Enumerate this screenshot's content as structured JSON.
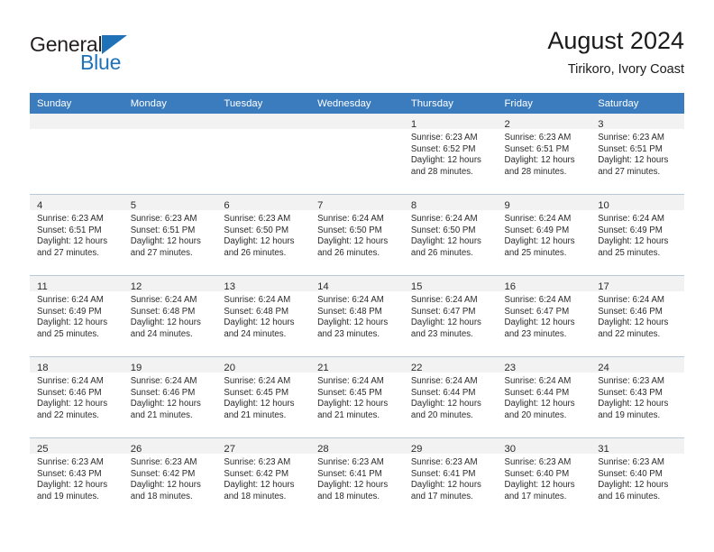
{
  "brand": {
    "name_top": "General",
    "name_bottom": "Blue",
    "accent_color": "#1f72b8",
    "text_color": "#231f20"
  },
  "header": {
    "title": "August 2024",
    "subtitle": "Tirikoro, Ivory Coast"
  },
  "theme": {
    "header_row_bg": "#3a7cbe",
    "daynum_band_bg": "#f2f2f2",
    "cell_bg": "#ffffff",
    "grid_line": "#b9c9d8",
    "text": "#2b2b2b"
  },
  "weekday_headers": [
    "Sunday",
    "Monday",
    "Tuesday",
    "Wednesday",
    "Thursday",
    "Friday",
    "Saturday"
  ],
  "weeks": [
    [
      {
        "day": "",
        "lines": []
      },
      {
        "day": "",
        "lines": []
      },
      {
        "day": "",
        "lines": []
      },
      {
        "day": "",
        "lines": []
      },
      {
        "day": "1",
        "lines": [
          "Sunrise: 6:23 AM",
          "Sunset: 6:52 PM",
          "Daylight: 12 hours",
          "and 28 minutes."
        ]
      },
      {
        "day": "2",
        "lines": [
          "Sunrise: 6:23 AM",
          "Sunset: 6:51 PM",
          "Daylight: 12 hours",
          "and 28 minutes."
        ]
      },
      {
        "day": "3",
        "lines": [
          "Sunrise: 6:23 AM",
          "Sunset: 6:51 PM",
          "Daylight: 12 hours",
          "and 27 minutes."
        ]
      }
    ],
    [
      {
        "day": "4",
        "lines": [
          "Sunrise: 6:23 AM",
          "Sunset: 6:51 PM",
          "Daylight: 12 hours",
          "and 27 minutes."
        ]
      },
      {
        "day": "5",
        "lines": [
          "Sunrise: 6:23 AM",
          "Sunset: 6:51 PM",
          "Daylight: 12 hours",
          "and 27 minutes."
        ]
      },
      {
        "day": "6",
        "lines": [
          "Sunrise: 6:23 AM",
          "Sunset: 6:50 PM",
          "Daylight: 12 hours",
          "and 26 minutes."
        ]
      },
      {
        "day": "7",
        "lines": [
          "Sunrise: 6:24 AM",
          "Sunset: 6:50 PM",
          "Daylight: 12 hours",
          "and 26 minutes."
        ]
      },
      {
        "day": "8",
        "lines": [
          "Sunrise: 6:24 AM",
          "Sunset: 6:50 PM",
          "Daylight: 12 hours",
          "and 26 minutes."
        ]
      },
      {
        "day": "9",
        "lines": [
          "Sunrise: 6:24 AM",
          "Sunset: 6:49 PM",
          "Daylight: 12 hours",
          "and 25 minutes."
        ]
      },
      {
        "day": "10",
        "lines": [
          "Sunrise: 6:24 AM",
          "Sunset: 6:49 PM",
          "Daylight: 12 hours",
          "and 25 minutes."
        ]
      }
    ],
    [
      {
        "day": "11",
        "lines": [
          "Sunrise: 6:24 AM",
          "Sunset: 6:49 PM",
          "Daylight: 12 hours",
          "and 25 minutes."
        ]
      },
      {
        "day": "12",
        "lines": [
          "Sunrise: 6:24 AM",
          "Sunset: 6:48 PM",
          "Daylight: 12 hours",
          "and 24 minutes."
        ]
      },
      {
        "day": "13",
        "lines": [
          "Sunrise: 6:24 AM",
          "Sunset: 6:48 PM",
          "Daylight: 12 hours",
          "and 24 minutes."
        ]
      },
      {
        "day": "14",
        "lines": [
          "Sunrise: 6:24 AM",
          "Sunset: 6:48 PM",
          "Daylight: 12 hours",
          "and 23 minutes."
        ]
      },
      {
        "day": "15",
        "lines": [
          "Sunrise: 6:24 AM",
          "Sunset: 6:47 PM",
          "Daylight: 12 hours",
          "and 23 minutes."
        ]
      },
      {
        "day": "16",
        "lines": [
          "Sunrise: 6:24 AM",
          "Sunset: 6:47 PM",
          "Daylight: 12 hours",
          "and 23 minutes."
        ]
      },
      {
        "day": "17",
        "lines": [
          "Sunrise: 6:24 AM",
          "Sunset: 6:46 PM",
          "Daylight: 12 hours",
          "and 22 minutes."
        ]
      }
    ],
    [
      {
        "day": "18",
        "lines": [
          "Sunrise: 6:24 AM",
          "Sunset: 6:46 PM",
          "Daylight: 12 hours",
          "and 22 minutes."
        ]
      },
      {
        "day": "19",
        "lines": [
          "Sunrise: 6:24 AM",
          "Sunset: 6:46 PM",
          "Daylight: 12 hours",
          "and 21 minutes."
        ]
      },
      {
        "day": "20",
        "lines": [
          "Sunrise: 6:24 AM",
          "Sunset: 6:45 PM",
          "Daylight: 12 hours",
          "and 21 minutes."
        ]
      },
      {
        "day": "21",
        "lines": [
          "Sunrise: 6:24 AM",
          "Sunset: 6:45 PM",
          "Daylight: 12 hours",
          "and 21 minutes."
        ]
      },
      {
        "day": "22",
        "lines": [
          "Sunrise: 6:24 AM",
          "Sunset: 6:44 PM",
          "Daylight: 12 hours",
          "and 20 minutes."
        ]
      },
      {
        "day": "23",
        "lines": [
          "Sunrise: 6:24 AM",
          "Sunset: 6:44 PM",
          "Daylight: 12 hours",
          "and 20 minutes."
        ]
      },
      {
        "day": "24",
        "lines": [
          "Sunrise: 6:23 AM",
          "Sunset: 6:43 PM",
          "Daylight: 12 hours",
          "and 19 minutes."
        ]
      }
    ],
    [
      {
        "day": "25",
        "lines": [
          "Sunrise: 6:23 AM",
          "Sunset: 6:43 PM",
          "Daylight: 12 hours",
          "and 19 minutes."
        ]
      },
      {
        "day": "26",
        "lines": [
          "Sunrise: 6:23 AM",
          "Sunset: 6:42 PM",
          "Daylight: 12 hours",
          "and 18 minutes."
        ]
      },
      {
        "day": "27",
        "lines": [
          "Sunrise: 6:23 AM",
          "Sunset: 6:42 PM",
          "Daylight: 12 hours",
          "and 18 minutes."
        ]
      },
      {
        "day": "28",
        "lines": [
          "Sunrise: 6:23 AM",
          "Sunset: 6:41 PM",
          "Daylight: 12 hours",
          "and 18 minutes."
        ]
      },
      {
        "day": "29",
        "lines": [
          "Sunrise: 6:23 AM",
          "Sunset: 6:41 PM",
          "Daylight: 12 hours",
          "and 17 minutes."
        ]
      },
      {
        "day": "30",
        "lines": [
          "Sunrise: 6:23 AM",
          "Sunset: 6:40 PM",
          "Daylight: 12 hours",
          "and 17 minutes."
        ]
      },
      {
        "day": "31",
        "lines": [
          "Sunrise: 6:23 AM",
          "Sunset: 6:40 PM",
          "Daylight: 12 hours",
          "and 16 minutes."
        ]
      }
    ]
  ]
}
